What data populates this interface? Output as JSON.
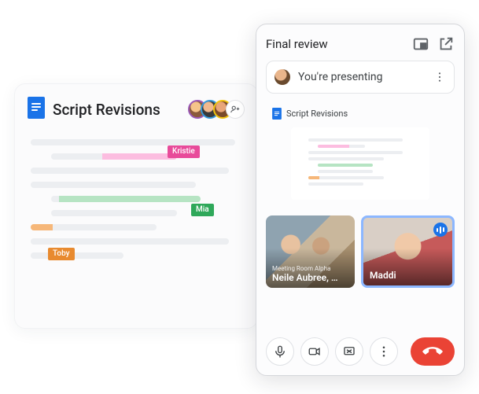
{
  "doc": {
    "title": "Script Revisions",
    "collaborators": [
      {
        "name": "Kristie",
        "color": "#e84b9a"
      },
      {
        "name": "Mia",
        "color": "#2fa85a"
      },
      {
        "name": "Toby",
        "color": "#e88a2f"
      }
    ]
  },
  "meet": {
    "title": "Final review",
    "presenting": {
      "status_text": "You're presenting",
      "shared_doc_title": "Script Revisions"
    },
    "participants": [
      {
        "room": "Meeting Room Alpha",
        "name_line": "Neile Aubree, …",
        "speaking": false
      },
      {
        "room": "",
        "name_line": "Maddi",
        "speaking": true
      }
    ],
    "controls": {
      "mic": "microphone-icon",
      "cam": "camera-icon",
      "share": "present-stop-icon",
      "more": "more-icon",
      "hangup": "hangup-icon"
    }
  }
}
